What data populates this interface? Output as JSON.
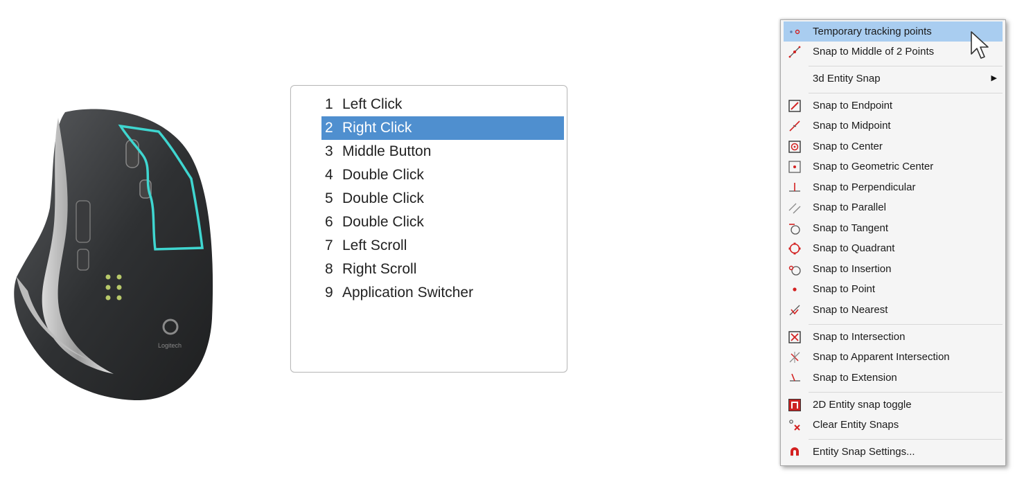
{
  "mouse": {
    "brand": "Logitech"
  },
  "button_list": {
    "items": [
      {
        "num": "1",
        "label": "Left Click",
        "selected": false
      },
      {
        "num": "2",
        "label": "Right Click",
        "selected": true
      },
      {
        "num": "3",
        "label": "Middle Button",
        "selected": false
      },
      {
        "num": "4",
        "label": "Double Click",
        "selected": false
      },
      {
        "num": "5",
        "label": "Double Click",
        "selected": false
      },
      {
        "num": "6",
        "label": "Double Click",
        "selected": false
      },
      {
        "num": "7",
        "label": "Left Scroll",
        "selected": false
      },
      {
        "num": "8",
        "label": "Right Scroll",
        "selected": false
      },
      {
        "num": "9",
        "label": "Application Switcher",
        "selected": false
      }
    ]
  },
  "context_menu": {
    "items": [
      {
        "label": "Temporary tracking points",
        "icon": "tracking-points-icon",
        "highlighted": true
      },
      {
        "label": "Snap to Middle of 2 Points",
        "icon": "middle-two-points-icon"
      },
      {
        "label": "3d Entity Snap",
        "icon": "",
        "submenu": true
      },
      {
        "label": "Snap to Endpoint",
        "icon": "endpoint-icon"
      },
      {
        "label": "Snap to Midpoint",
        "icon": "midpoint-icon"
      },
      {
        "label": "Snap to Center",
        "icon": "center-icon"
      },
      {
        "label": "Snap to Geometric Center",
        "icon": "geometric-center-icon"
      },
      {
        "label": "Snap to Perpendicular",
        "icon": "perpendicular-icon"
      },
      {
        "label": "Snap to Parallel",
        "icon": "parallel-icon"
      },
      {
        "label": "Snap to Tangent",
        "icon": "tangent-icon"
      },
      {
        "label": "Snap to Quadrant",
        "icon": "quadrant-icon"
      },
      {
        "label": "Snap to Insertion",
        "icon": "insertion-icon"
      },
      {
        "label": "Snap to Point",
        "icon": "point-icon"
      },
      {
        "label": "Snap to Nearest",
        "icon": "nearest-icon"
      },
      {
        "label": "Snap to Intersection",
        "icon": "intersection-icon"
      },
      {
        "label": "Snap to Apparent Intersection",
        "icon": "apparent-intersection-icon"
      },
      {
        "label": "Snap to Extension",
        "icon": "extension-icon"
      },
      {
        "label": "2D Entity snap toggle",
        "icon": "entity-snap-toggle-icon"
      },
      {
        "label": "Clear Entity Snaps",
        "icon": "clear-snaps-icon"
      },
      {
        "label": "Entity Snap Settings...",
        "icon": "magnet-icon"
      }
    ],
    "submenu_arrow": "▶"
  },
  "colors": {
    "selection": "#4f8fcf",
    "menu_highlight": "#a9cdf0",
    "snap_icon_red": "#d32020",
    "mouse_outline_accent": "#3fd6d0"
  }
}
